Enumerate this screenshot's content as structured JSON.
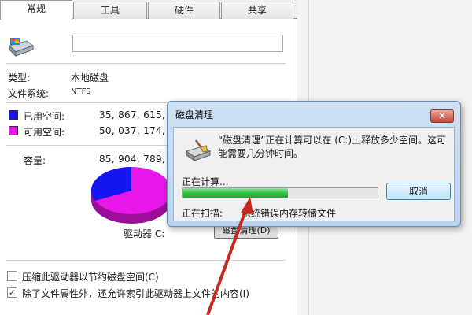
{
  "properties": {
    "tabs": [
      "常规",
      "工具",
      "硬件",
      "共享"
    ],
    "active_tab": "常规",
    "name_value": "",
    "type_label": "类型:",
    "type_value": "本地磁盘",
    "fs_label": "文件系统:",
    "fs_value": "NTFS",
    "used_label": "已用空间:",
    "used_value": "35, 867, 615, 2",
    "free_label": "可用空间:",
    "free_value": "50, 037, 174, 2",
    "capacity_label": "容量:",
    "capacity_value": "85, 904, 789, 5",
    "drive_label": "驱动器 C:",
    "cleanup_button": "磁盘清理(D)",
    "compress_label": "压缩此驱动器以节约磁盘空间(C)",
    "compress_checked": false,
    "index_label": "除了文件属性外，还允许索引此驱动器上文件的内容(I)",
    "index_checked": true,
    "colors": {
      "used": "#1515f0",
      "free": "#e817e8"
    }
  },
  "dialog": {
    "title": "磁盘清理",
    "message": "“磁盘清理”正在计算可以在 (C:)上释放多少空间。这可能需要几分钟时间。",
    "computing_label": "正在计算...",
    "progress": 0.54,
    "cancel_label": "取消",
    "scanning_label": "正在扫描:",
    "scanning_value": "系统错误内存转储文件",
    "close_label": "✕"
  },
  "annotation": {
    "arrow_color": "#c8281e"
  }
}
